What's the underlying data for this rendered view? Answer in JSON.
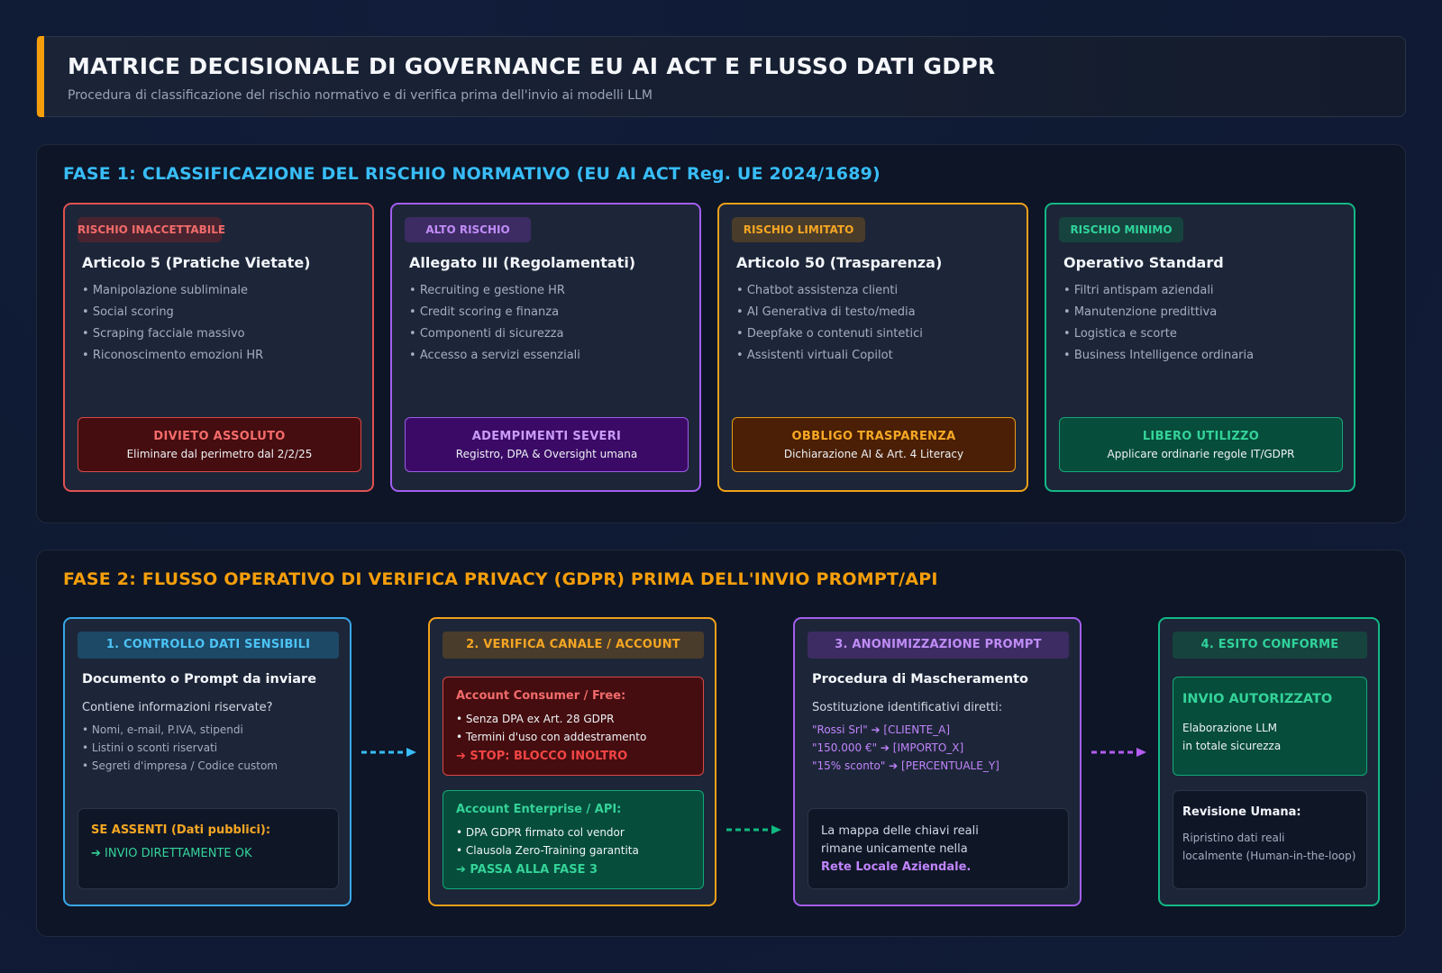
{
  "header": {
    "title": "MATRICE DECISIONALE DI GOVERNANCE EU AI ACT E FLUSSO DATI GDPR",
    "subtitle": "Procedura di classificazione del rischio normativo e di verifica prima dell'invio ai modelli LLM"
  },
  "phase1": {
    "title": "FASE 1: CLASSIFICAZIONE DEL RISCHIO NORMATIVO (EU AI ACT Reg. UE 2024/1689)",
    "cards": [
      {
        "badge": "RISCHIO INACCETTABILE",
        "heading": "Articolo 5 (Pratiche Vietate)",
        "items": [
          "Manipolazione subliminale",
          "Social scoring",
          "Scraping facciale massivo",
          "Riconoscimento emozioni HR"
        ],
        "footer_title": "DIVIETO ASSOLUTO",
        "footer_sub": "Eliminare dal perimetro dal 2/2/25",
        "color": "#ef5350"
      },
      {
        "badge": "ALTO RISCHIO",
        "heading": "Allegato III (Regolamentati)",
        "items": [
          "Recruiting e gestione HR",
          "Credit scoring e finanza",
          "Componenti di sicurezza",
          "Accesso a servizi essenziali"
        ],
        "footer_title": "ADEMPIMENTI SEVERI",
        "footer_sub": "Registro, DPA & Oversight umana",
        "color": "#a855f7"
      },
      {
        "badge": "RISCHIO LIMITATO",
        "heading": "Articolo 50 (Trasparenza)",
        "items": [
          "Chatbot assistenza clienti",
          "AI Generativa di testo/media",
          "Deepfake o contenuti sintetici",
          "Assistenti virtuali Copilot"
        ],
        "footer_title": "OBBLIGO TRASPARENZA",
        "footer_sub": "Dichiarazione AI & Art. 4 Literacy",
        "color": "#f59e0b"
      },
      {
        "badge": "RISCHIO MINIMO",
        "heading": "Operativo Standard",
        "items": [
          "Filtri antispam aziendali",
          "Manutenzione predittiva",
          "Logistica e scorte",
          "Business Intelligence ordinaria"
        ],
        "footer_title": "LIBERO UTILIZZO",
        "footer_sub": "Applicare ordinarie regole IT/GDPR",
        "color": "#10b981"
      }
    ]
  },
  "phase2": {
    "title": "FASE 2: FLUSSO OPERATIVO DI VERIFICA PRIVACY (GDPR) PRIMA DELL'INVIO PROMPT/API",
    "step1": {
      "badge": "1. CONTROLLO DATI SENSIBILI",
      "heading": "Documento o Prompt da inviare",
      "question": "Contiene informazioni riservate?",
      "items": [
        "Nomi, e-mail, P.IVA, stipendi",
        "Listini o sconti riservati",
        "Segreti d'impresa / Codice custom"
      ],
      "box_title": "SE ASSENTI (Dati pubblici):",
      "box_action": "➔ INVIO DIRETTAMENTE OK"
    },
    "step2": {
      "badge": "2. VERIFICA CANALE / ACCOUNT",
      "consumer_title": "Account Consumer / Free:",
      "consumer_items": [
        "Senza DPA ex Art. 28 GDPR",
        "Termini d'uso con addestramento"
      ],
      "consumer_action": "➔ STOP: BLOCCO INOLTRO",
      "enterprise_title": "Account Enterprise / API:",
      "enterprise_items": [
        "DPA GDPR firmato col vendor",
        "Clausola Zero-Training garantita"
      ],
      "enterprise_action": "➔ PASSA ALLA FASE 3"
    },
    "step3": {
      "badge": "3. ANONIMIZZAZIONE PROMPT",
      "heading": "Procedura di Mascheramento",
      "intro": "Sostituzione identificativi diretti:",
      "mappings": [
        "\"Rossi Srl\" ➔ [CLIENTE_A]",
        "\"150.000 €\" ➔ [IMPORTO_X]",
        "\"15% sconto\" ➔ [PERCENTUALE_Y]"
      ],
      "note_line1": "La mappa delle chiavi reali",
      "note_line2": "rimane unicamente nella",
      "note_bold": "Rete Locale Aziendale."
    },
    "step4": {
      "badge": "4. ESITO CONFORME",
      "ok_title": "INVIO AUTORIZZATO",
      "ok_line1": "Elaborazione LLM",
      "ok_line2": "in totale sicurezza",
      "review_title": "Revisione Umana:",
      "review_line1": "Ripristino dati reali",
      "review_line2": "localmente (Human-in-the-loop)"
    }
  },
  "colors": {
    "blue": "#38bdf8",
    "orange": "#f59e0b",
    "purple": "#a855f7",
    "green": "#10b981",
    "red": "#ef5350"
  },
  "icons": [
    "dashed-arrow-right",
    "dashed-arrow-right",
    "dashed-arrow-right"
  ]
}
